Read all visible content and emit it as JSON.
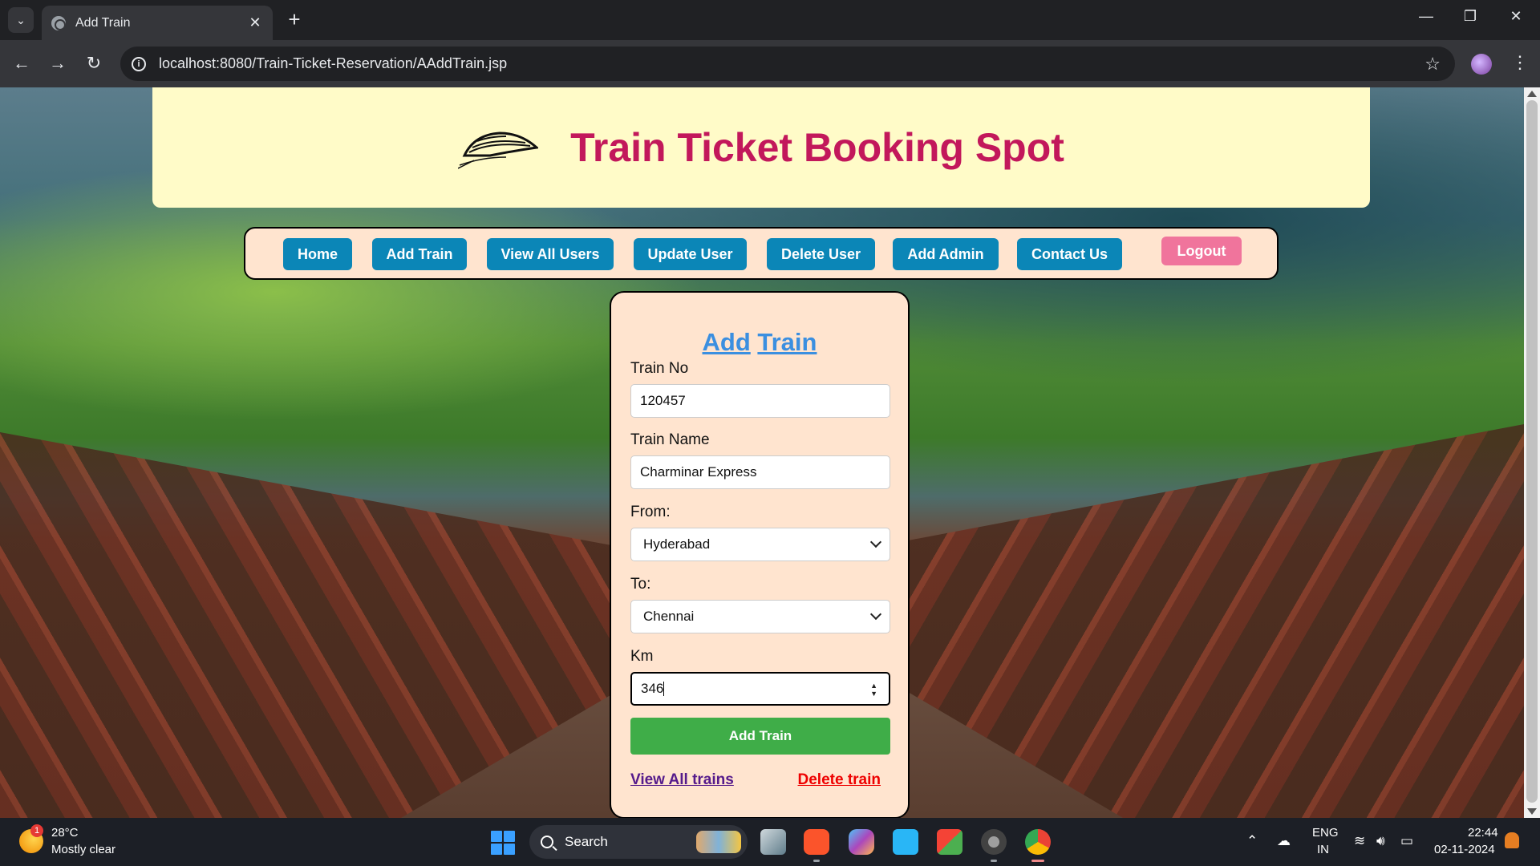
{
  "browser": {
    "tab_title": "Add Train",
    "url": "localhost:8080/Train-Ticket-Reservation/AAddTrain.jsp"
  },
  "header": {
    "title": "Train Ticket Booking Spot"
  },
  "nav": {
    "items": [
      "Home",
      "Add Train",
      "View All Users",
      "Update User",
      "Delete User",
      "Add Admin",
      "Contact Us"
    ],
    "logout": "Logout"
  },
  "form": {
    "heading_part1": "Add",
    "heading_part2": "Train",
    "train_no_label": "Train No",
    "train_no_value": "120457",
    "train_name_label": "Train Name",
    "train_name_value": "Charminar Express",
    "from_label": "From:",
    "from_value": "Hyderabad",
    "to_label": "To:",
    "to_value": "Chennai",
    "km_label": "Km",
    "km_value": "346",
    "submit_label": "Add Train",
    "view_link": "View All trains",
    "delete_link": "Delete train"
  },
  "taskbar": {
    "weather_badge": "1",
    "temperature": "28°C",
    "weather_desc": "Mostly clear",
    "search_label": "Search",
    "lang_primary": "ENG",
    "lang_secondary": "IN",
    "time": "22:44",
    "date": "02-11-2024"
  },
  "colors": {
    "title": "#c2185b",
    "nav_button": "#0b86b7",
    "logout_button": "#f0749c",
    "submit_button": "#3fad48",
    "heading_link": "#3b8fe0",
    "card_bg": "#ffe4cf",
    "header_bg": "#fffbc8"
  }
}
